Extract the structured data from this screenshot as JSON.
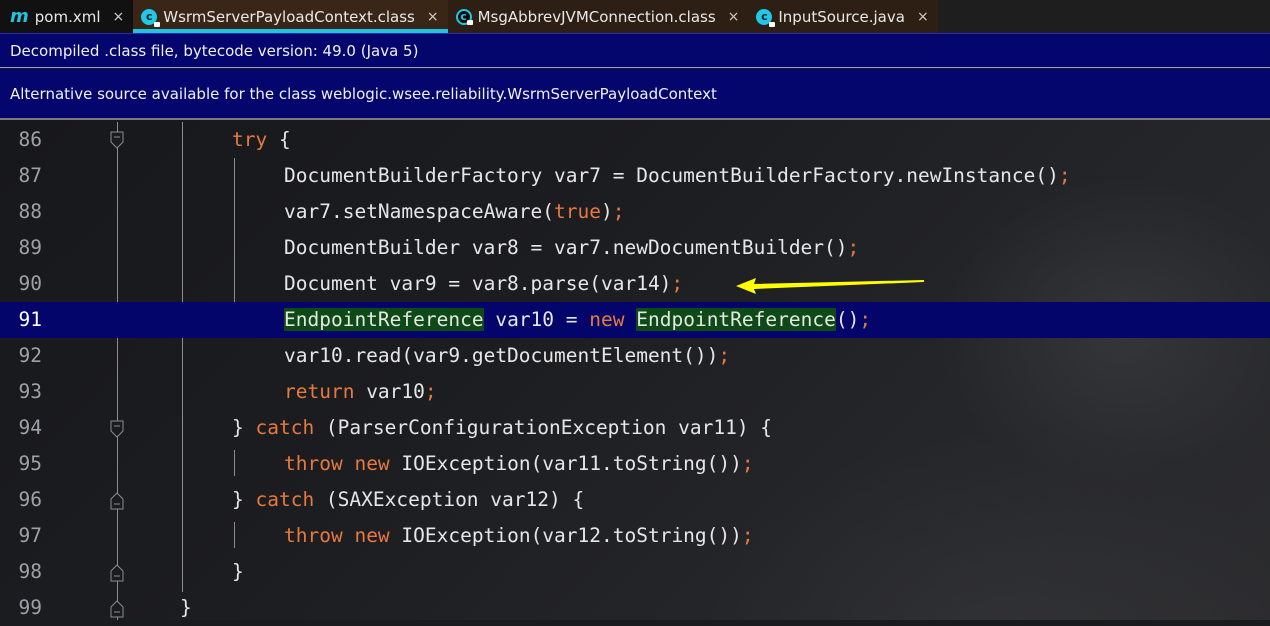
{
  "tabs": [
    {
      "label": "pom.xml",
      "icon": "maven-m-icon",
      "active": false
    },
    {
      "label": "WsrmServerPayloadContext.class",
      "icon": "class-c-locked-icon",
      "active": true
    },
    {
      "label": "MsgAbbrevJVMConnection.class",
      "icon": "class-c-locked-icon",
      "active": false
    },
    {
      "label": "InputSource.java",
      "icon": "class-c-locked-icon",
      "active": false
    }
  ],
  "tab_close_glyph": "×",
  "banners": {
    "decompiled": "Decompiled .class file, bytecode version: 49.0 (Java 5)",
    "alternative": "Alternative source available for the class weblogic.wsee.reliability.WsrmServerPayloadContext"
  },
  "colors": {
    "accent_tab_underline": "#22c4de",
    "banner_bg": "#04066e",
    "current_line_bg": "#03056a",
    "keyword": "#e8793e",
    "highlight_usage": "#0d4a16",
    "arrow": "#ffff00"
  },
  "editor": {
    "current_line": 91,
    "lines": [
      {
        "num": "86",
        "tokens": [
          {
            "t": "try",
            "k": "kw"
          },
          {
            "t": " {"
          }
        ]
      },
      {
        "num": "87",
        "tokens": [
          {
            "t": "DocumentBuilderFactory var7 = DocumentBuilderFactory.newInstance()"
          },
          {
            "t": ";",
            "k": "semi"
          }
        ]
      },
      {
        "num": "88",
        "tokens": [
          {
            "t": "var7.setNamespaceAware("
          },
          {
            "t": "true",
            "k": "kw"
          },
          {
            "t": ")"
          },
          {
            "t": ";",
            "k": "semi"
          }
        ]
      },
      {
        "num": "89",
        "tokens": [
          {
            "t": "DocumentBuilder var8 = var7.newDocumentBuilder()"
          },
          {
            "t": ";",
            "k": "semi"
          }
        ]
      },
      {
        "num": "90",
        "tokens": [
          {
            "t": "Document var9 = var8.parse(var14)"
          },
          {
            "t": ";",
            "k": "semi"
          }
        ]
      },
      {
        "num": "91",
        "tokens": [
          {
            "t": "EndpointReference",
            "k": "hl"
          },
          {
            "t": " var10 = "
          },
          {
            "t": "new",
            "k": "kw"
          },
          {
            "t": " "
          },
          {
            "t": "EndpointReference",
            "k": "hl"
          },
          {
            "t": "()"
          },
          {
            "t": ";",
            "k": "semi"
          }
        ]
      },
      {
        "num": "92",
        "tokens": [
          {
            "t": "var10.read(var9.getDocumentElement())"
          },
          {
            "t": ";",
            "k": "semi"
          }
        ]
      },
      {
        "num": "93",
        "tokens": [
          {
            "t": "return",
            "k": "kw"
          },
          {
            "t": " var10"
          },
          {
            "t": ";",
            "k": "semi"
          }
        ]
      },
      {
        "num": "94",
        "tokens": [
          {
            "t": "} "
          },
          {
            "t": "catch",
            "k": "kw"
          },
          {
            "t": " (ParserConfigurationException var11) {"
          }
        ]
      },
      {
        "num": "95",
        "tokens": [
          {
            "t": "throw",
            "k": "kw"
          },
          {
            "t": " "
          },
          {
            "t": "new",
            "k": "kw"
          },
          {
            "t": " IOException(var11.toString())"
          },
          {
            "t": ";",
            "k": "semi"
          }
        ]
      },
      {
        "num": "96",
        "tokens": [
          {
            "t": "} "
          },
          {
            "t": "catch",
            "k": "kw"
          },
          {
            "t": " (SAXException var12) {"
          }
        ]
      },
      {
        "num": "97",
        "tokens": [
          {
            "t": "throw",
            "k": "kw"
          },
          {
            "t": " "
          },
          {
            "t": "new",
            "k": "kw"
          },
          {
            "t": " IOException(var12.toString())"
          },
          {
            "t": ";",
            "k": "semi"
          }
        ]
      },
      {
        "num": "98",
        "tokens": [
          {
            "t": "}"
          }
        ]
      },
      {
        "num": "99",
        "tokens": [
          {
            "t": "}"
          }
        ]
      }
    ],
    "annotation": {
      "type": "arrow-pointer",
      "target_line": 90
    }
  }
}
